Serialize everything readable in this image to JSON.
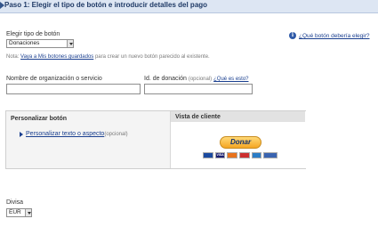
{
  "header": {
    "step_title": "Paso 1: Elegir el tipo de botón e introducir detalles del pago"
  },
  "button_type": {
    "label": "Elegir tipo de botón",
    "selected": "Donaciones",
    "help_link": "¿Qué botón debería elegir?"
  },
  "note": {
    "prefix": "Nota: ",
    "link": "Vaya a Mis botones guardados",
    "suffix": " para crear un nuevo botón parecido al existente."
  },
  "organization": {
    "label": "Nombre de organización o servicio",
    "value": ""
  },
  "donation_id": {
    "label": "Id. de donación",
    "optional": "(opcional)",
    "help_link": "¿Qué es esto?",
    "value": ""
  },
  "customize": {
    "heading": "Personalizar botón",
    "link": "Personalizar texto o aspecto",
    "optional": "(opcional)"
  },
  "preview": {
    "heading": "Vista de cliente",
    "button_label": "Donar",
    "cards": [
      {
        "icon": "maestro-card-icon",
        "label": "",
        "color": "#1b4aa0"
      },
      {
        "icon": "visa-card-icon",
        "label": "VISA",
        "color": "#1a1f71"
      },
      {
        "icon": "mastercard-icon",
        "label": "",
        "color": "#e8731c"
      },
      {
        "icon": "mastercard-alt-icon",
        "label": "",
        "color": "#cc2f2f"
      },
      {
        "icon": "amex-card-icon",
        "label": "",
        "color": "#2a7cc6"
      },
      {
        "icon": "bank-transfer-icon",
        "label": "",
        "color": "#3a64b0"
      }
    ]
  },
  "currency": {
    "label": "Divisa",
    "selected": "EUR"
  },
  "colors": {
    "link": "#1a3f8f",
    "header_bg": "#dde6f3",
    "donate_button": "#f5a623"
  }
}
